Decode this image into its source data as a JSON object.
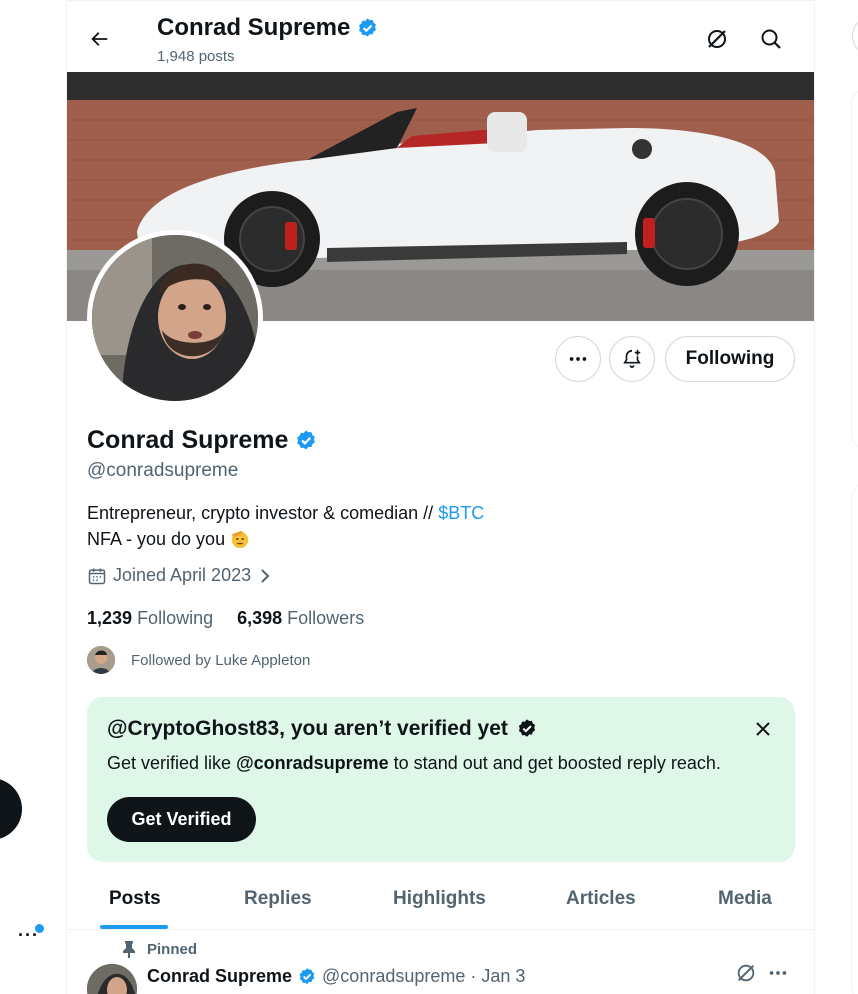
{
  "header": {
    "name": "Conrad Supreme",
    "posts_count": "1,948 posts"
  },
  "profile": {
    "name": "Conrad Supreme",
    "handle": "@conradsupreme",
    "bio_line1_text": "Entrepreneur, crypto investor & comedian // ",
    "bio_link": "$BTC",
    "bio_line2_text": "NFA - you do you",
    "joined": "Joined April 2023",
    "following_count": "1,239",
    "following_label": "Following",
    "followers_count": "6,398",
    "followers_label": "Followers",
    "followed_by": "Followed by Luke Appleton",
    "following_button": "Following"
  },
  "verify_card": {
    "title": "@CryptoGhost83, you aren’t verified yet",
    "desc_prefix": "Get verified like ",
    "desc_handle": "@conradsupreme",
    "desc_suffix": " to stand out and get boosted reply reach.",
    "button": "Get Verified"
  },
  "tabs": [
    "Posts",
    "Replies",
    "Highlights",
    "Articles",
    "Media"
  ],
  "pinned_post": {
    "pinned_label": "Pinned",
    "name": "Conrad Supreme",
    "meta": "@conradsupreme · Jan 3"
  },
  "colors": {
    "accent": "#1d9bf0",
    "verify_bg": "#def7e8",
    "text": "#0f1419",
    "muted": "#536471"
  },
  "icons": {
    "back": "arrow-left-icon",
    "grok": "grok-slash-icon",
    "search": "search-icon",
    "more": "more-dots-icon",
    "notify": "bell-plus-icon",
    "verified": "verified-badge-icon",
    "calendar": "calendar-icon",
    "chevron": "chevron-right-icon",
    "close": "close-icon",
    "pin": "pin-icon"
  }
}
